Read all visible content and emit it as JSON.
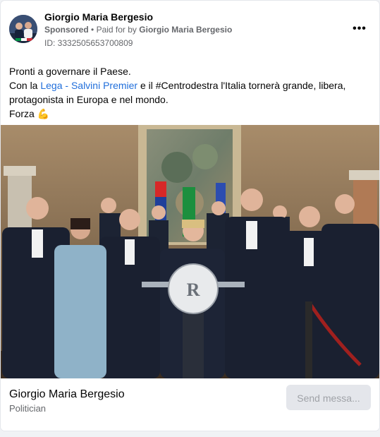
{
  "header": {
    "poster_name": "Giorgio Maria Bergesio",
    "sponsored": "Sponsored",
    "paid_prefix": "Paid for by",
    "paid_by": "Giorgio Maria Bergesio",
    "ad_id": "ID: 3332505653700809",
    "more_label": "•••"
  },
  "post": {
    "line1": "Pronti a governare il Paese.",
    "line2_pre": "Con la ",
    "link_lega": "Lega - Salvini Premier",
    "line2_post": " e il #Centrodestra l'Italia tornerà grande, libera, protagonista in Europa e nel mondo.",
    "line3": "Forza",
    "emoji": "💪"
  },
  "footer": {
    "name": "Giorgio Maria Bergesio",
    "category": "Politician",
    "send_label": "Send messa..."
  },
  "colors": {
    "link": "#216fdb",
    "secondary_text": "#65676b",
    "button_bg": "#e4e6eb"
  }
}
